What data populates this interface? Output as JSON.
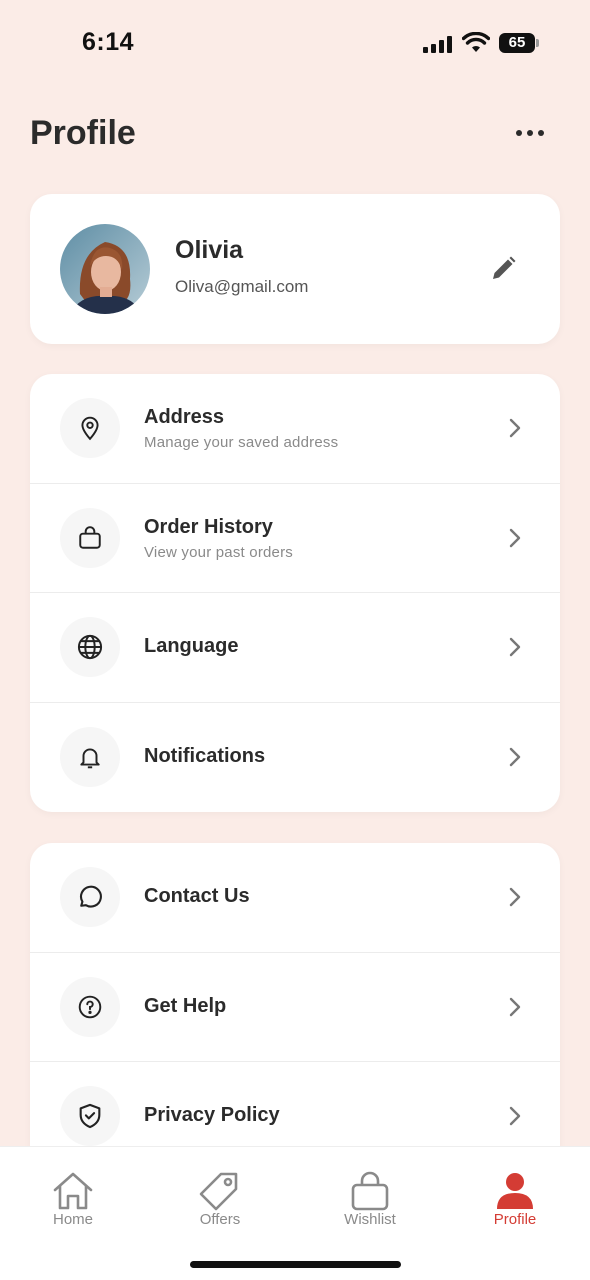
{
  "status_bar": {
    "time": "6:14",
    "battery": "65"
  },
  "header": {
    "title": "Profile",
    "more_icon": "more-horizontal-icon"
  },
  "profile": {
    "name": "Olivia",
    "email": "Oliva@gmail.com",
    "edit_icon": "pencil-icon"
  },
  "menu_group_1": [
    {
      "title": "Address",
      "subtitle": "Manage your saved address",
      "icon": "location-pin-icon"
    },
    {
      "title": "Order History",
      "subtitle": "View your past orders",
      "icon": "shopping-bag-icon"
    },
    {
      "title": "Language",
      "icon": "globe-icon"
    },
    {
      "title": "Notifications",
      "icon": "bell-icon"
    }
  ],
  "menu_group_2": [
    {
      "title": "Contact Us",
      "icon": "chat-bubble-icon"
    },
    {
      "title": "Get Help",
      "icon": "question-circle-icon"
    },
    {
      "title": "Privacy Policy",
      "icon": "shield-check-icon"
    }
  ],
  "bottom_nav": [
    {
      "label": "Home",
      "icon": "home-icon",
      "active": false
    },
    {
      "label": "Offers",
      "icon": "tag-icon",
      "active": false
    },
    {
      "label": "Wishlist",
      "icon": "bag-icon",
      "active": false
    },
    {
      "label": "Profile",
      "icon": "user-icon",
      "active": true
    }
  ],
  "colors": {
    "background": "#fbece7",
    "accent": "#d43c34",
    "text": "#2b2b2b",
    "muted": "#8a8a8a"
  }
}
